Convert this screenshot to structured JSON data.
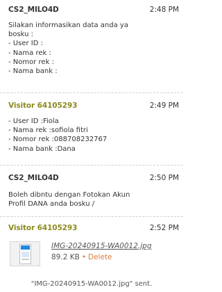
{
  "messages": [
    {
      "sender": "CS2_MILO4D",
      "time": "2:48 PM",
      "lines": [
        "Silakan informasikan data anda ya",
        "bosku :",
        "- User ID :",
        "- Nama rek :",
        "- Nomor rek :",
        "- Nama bank :"
      ]
    },
    {
      "sender": "Visitor 64105293",
      "time": "2:49 PM",
      "lines": [
        "- User ID :Fiola",
        "- Nama rek :sofiola fitri",
        "- Nomor rek :088708232767",
        "- Nama bank :Dana"
      ]
    },
    {
      "sender": "CS2_MILO4D",
      "time": "2:50 PM",
      "lines": [
        "Boleh dibntu dengan Fotokan Akun",
        "Profil DANA anda bosku /"
      ]
    },
    {
      "sender": "Visitor 64105293",
      "time": "2:52 PM",
      "attachment": {
        "file_name": "IMG-20240915-WA0012.jpg",
        "file_size": "89.2 KB",
        "separator": "•",
        "delete_label": "Delete"
      }
    }
  ],
  "sent_note": "\"IMG-20240915-WA0012.jpg\" sent.",
  "colors": {
    "agent_name": "#333333",
    "visitor_name": "#8d8a21",
    "delete_link": "#e07b39",
    "divider": "#cfcfcf"
  }
}
